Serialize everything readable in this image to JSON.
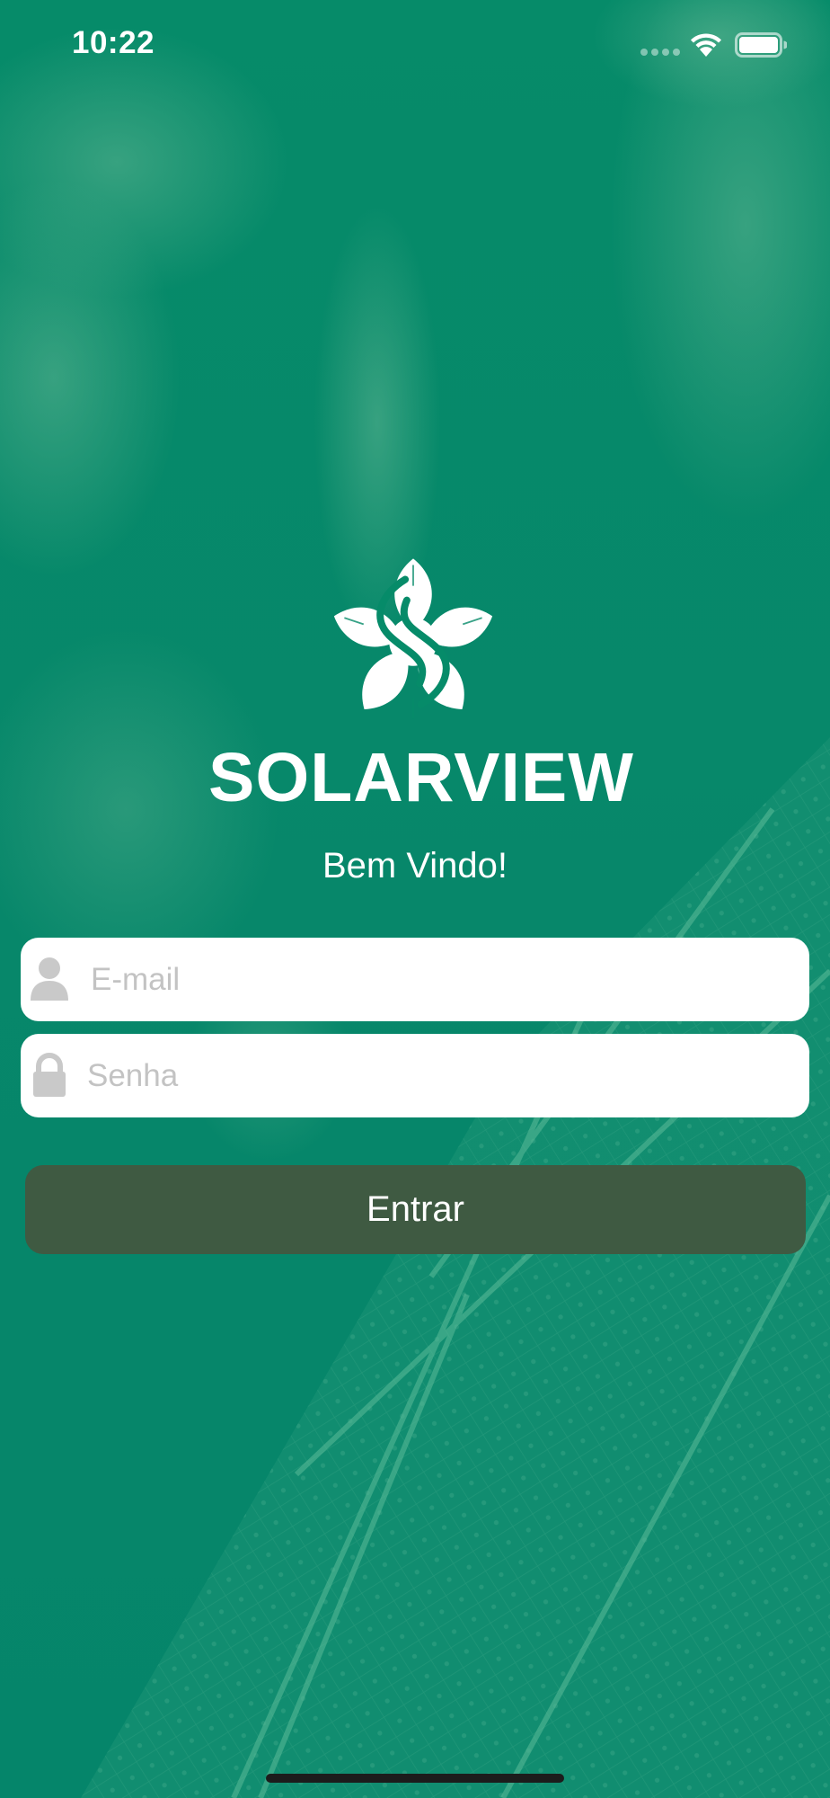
{
  "status_bar": {
    "time": "10:22",
    "wifi_icon": "wifi-icon",
    "battery_icon": "battery-icon"
  },
  "login": {
    "logo_icon": "solarview-flower-logo-icon",
    "brand_name": "SOLARVIEW",
    "welcome": "Bem Vindo!",
    "email": {
      "value": "",
      "placeholder": "E-mail",
      "icon": "user-icon"
    },
    "password": {
      "value": "",
      "placeholder": "Senha",
      "icon": "lock-icon"
    },
    "submit_label": "Entrar"
  },
  "colors": {
    "background": "#058a67",
    "button": "#3f5a42",
    "placeholder": "#c3c3c3"
  }
}
